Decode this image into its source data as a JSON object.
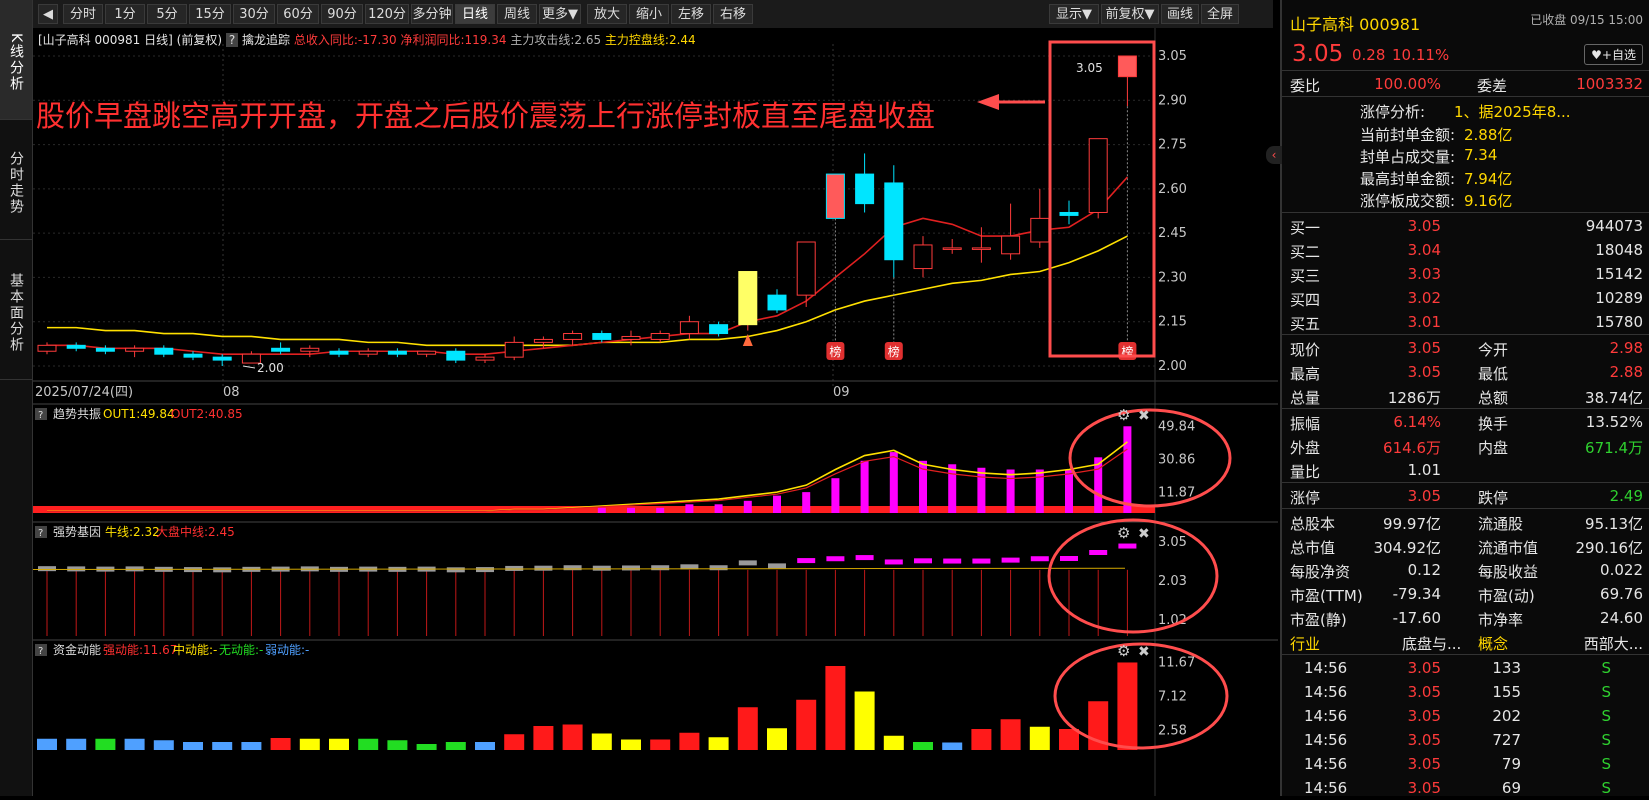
{
  "toolbar": {
    "periods": [
      "分时",
      "1分",
      "5分",
      "15分",
      "30分",
      "60分",
      "90分",
      "120分",
      "多分钟",
      "日线",
      "周线",
      "更多▼"
    ],
    "active": "日线",
    "tools": [
      "放大",
      "缩小",
      "左移",
      "右移"
    ],
    "right_tools": [
      "显示▼",
      "前复权▼",
      "画线",
      "全屏"
    ]
  },
  "left_nav": [
    "K线分析",
    "分时走势",
    "基本面分析"
  ],
  "main_header": {
    "stock": "[山子高科 000981 日线]",
    "adj": "(前复权)",
    "help": "?",
    "indicator": "擒龙追踪",
    "income": "总收入同比:-17.30",
    "profit": "净利润同比:119.34",
    "attack": "主力攻击线:2.65",
    "control": "主力控盘线:2.44"
  },
  "annotation": "股价早盘跳空高开开盘，开盘之后股价震荡上行涨停封板直至尾盘收盘",
  "price_axis": [
    "3.05",
    "2.90",
    "2.75",
    "2.60",
    "2.45",
    "2.30",
    "2.15",
    "2.00"
  ],
  "date_labels": [
    "2025/07/24(四)",
    "08",
    "09"
  ],
  "low_label": "2.00",
  "high_label": "3.05",
  "bang_label": "榜",
  "panel1": {
    "name": "趋势共振",
    "out1": "OUT1:49.84",
    "out2": "OUT2:40.85",
    "axis": [
      "49.84",
      "30.86",
      "11.87"
    ]
  },
  "panel2": {
    "name": "强势基因",
    "bull": "牛线:2.32",
    "market": "大盘中线:2.45",
    "axis": [
      "3.05",
      "2.03",
      "1.02"
    ]
  },
  "panel3": {
    "name": "资金动能",
    "strong": "强动能:11.67",
    "mid": "中动能:-",
    "none": "无动能:-",
    "weak": "弱动能:-",
    "axis": [
      "11.67",
      "7.12",
      "2.58"
    ]
  },
  "colors": {
    "up": "#ff3b3b",
    "down": "#00e5ff",
    "ma_yellow": "#ffe000",
    "ma_red": "#e02020",
    "magenta": "#ff00ff",
    "frame": "#ff4d4d"
  },
  "chart_data": {
    "type": "candlestick",
    "ylim": [
      2.0,
      3.1
    ],
    "candles": [
      {
        "o": 2.05,
        "h": 2.08,
        "l": 2.04,
        "c": 2.07
      },
      {
        "o": 2.07,
        "h": 2.08,
        "l": 2.05,
        "c": 2.06
      },
      {
        "o": 2.06,
        "h": 2.07,
        "l": 2.04,
        "c": 2.05
      },
      {
        "o": 2.05,
        "h": 2.07,
        "l": 2.03,
        "c": 2.06
      },
      {
        "o": 2.06,
        "h": 2.07,
        "l": 2.03,
        "c": 2.04
      },
      {
        "o": 2.04,
        "h": 2.05,
        "l": 2.02,
        "c": 2.03
      },
      {
        "o": 2.03,
        "h": 2.04,
        "l": 2.0,
        "c": 2.02
      },
      {
        "o": 2.01,
        "h": 2.05,
        "l": 2.01,
        "c": 2.04
      },
      {
        "o": 2.06,
        "h": 2.08,
        "l": 2.04,
        "c": 2.05
      },
      {
        "o": 2.05,
        "h": 2.07,
        "l": 2.03,
        "c": 2.06
      },
      {
        "o": 2.05,
        "h": 2.06,
        "l": 2.03,
        "c": 2.04
      },
      {
        "o": 2.04,
        "h": 2.06,
        "l": 2.03,
        "c": 2.05
      },
      {
        "o": 2.05,
        "h": 2.06,
        "l": 2.03,
        "c": 2.04
      },
      {
        "o": 2.04,
        "h": 2.05,
        "l": 2.03,
        "c": 2.05
      },
      {
        "o": 2.05,
        "h": 2.06,
        "l": 2.01,
        "c": 2.02
      },
      {
        "o": 2.02,
        "h": 2.04,
        "l": 2.01,
        "c": 2.03
      },
      {
        "o": 2.03,
        "h": 2.1,
        "l": 2.02,
        "c": 2.08
      },
      {
        "o": 2.08,
        "h": 2.1,
        "l": 2.06,
        "c": 2.09
      },
      {
        "o": 2.09,
        "h": 2.12,
        "l": 2.07,
        "c": 2.11
      },
      {
        "o": 2.11,
        "h": 2.12,
        "l": 2.08,
        "c": 2.09
      },
      {
        "o": 2.09,
        "h": 2.12,
        "l": 2.07,
        "c": 2.1
      },
      {
        "o": 2.09,
        "h": 2.12,
        "l": 2.08,
        "c": 2.11
      },
      {
        "o": 2.11,
        "h": 2.17,
        "l": 2.09,
        "c": 2.15
      },
      {
        "o": 2.14,
        "h": 2.15,
        "l": 2.1,
        "c": 2.11
      },
      {
        "o": 2.14,
        "h": 2.3,
        "l": 2.12,
        "c": 2.32
      },
      {
        "o": 2.24,
        "h": 2.26,
        "l": 2.18,
        "c": 2.19
      },
      {
        "o": 2.24,
        "h": 2.42,
        "l": 2.2,
        "c": 2.42
      },
      {
        "o": 2.65,
        "h": 2.65,
        "l": 2.5,
        "c": 2.5
      },
      {
        "o": 2.65,
        "h": 2.72,
        "l": 2.52,
        "c": 2.55
      },
      {
        "o": 2.62,
        "h": 2.68,
        "l": 2.3,
        "c": 2.36
      },
      {
        "o": 2.33,
        "h": 2.44,
        "l": 2.3,
        "c": 2.41
      },
      {
        "o": 2.4,
        "h": 2.43,
        "l": 2.38,
        "c": 2.4
      },
      {
        "o": 2.4,
        "h": 2.47,
        "l": 2.35,
        "c": 2.4
      },
      {
        "o": 2.38,
        "h": 2.55,
        "l": 2.36,
        "c": 2.44
      },
      {
        "o": 2.42,
        "h": 2.6,
        "l": 2.4,
        "c": 2.5
      },
      {
        "o": 2.52,
        "h": 2.56,
        "l": 2.48,
        "c": 2.51
      },
      {
        "o": 2.52,
        "h": 2.77,
        "l": 2.5,
        "c": 2.77
      },
      {
        "o": 2.98,
        "h": 3.05,
        "l": 2.88,
        "c": 3.05
      }
    ],
    "ma_red": [
      2.07,
      2.07,
      2.06,
      2.06,
      2.06,
      2.05,
      2.04,
      2.04,
      2.04,
      2.04,
      2.05,
      2.05,
      2.05,
      2.05,
      2.04,
      2.04,
      2.05,
      2.06,
      2.07,
      2.08,
      2.09,
      2.1,
      2.11,
      2.11,
      2.15,
      2.17,
      2.22,
      2.3,
      2.38,
      2.47,
      2.5,
      2.48,
      2.44,
      2.44,
      2.46,
      2.47,
      2.53,
      2.64
    ],
    "ma_yellow": [
      2.13,
      2.13,
      2.12,
      2.12,
      2.11,
      2.11,
      2.1,
      2.1,
      2.09,
      2.09,
      2.09,
      2.08,
      2.08,
      2.07,
      2.07,
      2.07,
      2.07,
      2.07,
      2.07,
      2.08,
      2.08,
      2.08,
      2.09,
      2.09,
      2.1,
      2.12,
      2.15,
      2.19,
      2.22,
      2.24,
      2.26,
      2.28,
      2.29,
      2.31,
      2.32,
      2.35,
      2.39,
      2.44
    ],
    "panel1_bars": [
      0,
      0,
      0,
      0,
      0,
      0,
      0,
      0,
      0,
      0,
      0,
      0,
      0,
      0,
      0,
      0,
      0,
      0,
      0,
      3,
      3,
      3,
      5,
      5,
      7,
      10,
      12,
      20,
      30,
      35,
      30,
      28,
      26,
      25,
      25,
      25,
      32,
      49.84
    ],
    "panel1_line": [
      1,
      1,
      1,
      1,
      1,
      1,
      1,
      1,
      1,
      1,
      1,
      1,
      1,
      1,
      1,
      1,
      2,
      2,
      3,
      4,
      5,
      6,
      7,
      8,
      10,
      12,
      16,
      25,
      33,
      36,
      28,
      25,
      23,
      22,
      23,
      25,
      28,
      40.85
    ],
    "panel3_bars": [
      1.5,
      1.5,
      1.5,
      1.5,
      1.3,
      -1,
      -1,
      -1,
      1.6,
      1.5,
      1.5,
      1.5,
      1.3,
      0.8,
      -1,
      -1,
      2.1,
      3.2,
      3.4,
      2.2,
      1.4,
      1.4,
      2.3,
      1.7,
      5.7,
      2.9,
      6.7,
      11.2,
      7.8,
      1.9,
      -3,
      1,
      2.8,
      4.1,
      3.1,
      2.8,
      6.5,
      11.67
    ],
    "panel3_colors": [
      "blue",
      "blue",
      "green",
      "blue",
      "blue",
      "blue",
      "blue",
      "blue",
      "red",
      "yellow",
      "yellow",
      "green",
      "green",
      "green",
      "green",
      "blue",
      "red",
      "red",
      "red",
      "yellow",
      "yellow",
      "red",
      "red",
      "yellow",
      "red",
      "yellow",
      "red",
      "red",
      "yellow",
      "yellow",
      "green",
      "blue",
      "red",
      "red",
      "yellow",
      "red",
      "red",
      "red"
    ]
  },
  "right": {
    "title": "山子高科 000981",
    "status": "已收盘 09/15 15:00",
    "price": "3.05",
    "change": "0.28",
    "pct": "10.11%",
    "add_btn": "♥+自选",
    "webi_label": "委比",
    "webi": "100.00%",
    "weicha_label": "委差",
    "weicha": "1003332",
    "zt_analysis_label": "涨停分析:",
    "zt_analysis": "1、据2025年8...",
    "zt_rows": [
      {
        "label": "当前封单金额:",
        "value": "2.88亿"
      },
      {
        "label": "封单占成交量:",
        "value": "7.34"
      },
      {
        "label": "最高封单金额:",
        "value": "7.94亿"
      },
      {
        "label": "涨停板成交额:",
        "value": "9.16亿"
      }
    ],
    "buy": [
      {
        "label": "买一",
        "price": "3.05",
        "vol": "944073"
      },
      {
        "label": "买二",
        "price": "3.04",
        "vol": "18048"
      },
      {
        "label": "买三",
        "price": "3.03",
        "vol": "15142"
      },
      {
        "label": "买四",
        "price": "3.02",
        "vol": "10289"
      },
      {
        "label": "买五",
        "price": "3.01",
        "vol": "15780"
      }
    ],
    "stats": [
      {
        "l1": "现价",
        "v1": "3.05",
        "c1": "red",
        "l2": "今开",
        "v2": "2.98",
        "c2": "red"
      },
      {
        "l1": "最高",
        "v1": "3.05",
        "c1": "red",
        "l2": "最低",
        "v2": "2.88",
        "c2": "red"
      },
      {
        "l1": "总量",
        "v1": "1286万",
        "c1": "white",
        "l2": "总额",
        "v2": "38.74亿",
        "c2": "white"
      }
    ],
    "stats2": [
      {
        "l1": "振幅",
        "v1": "6.14%",
        "c1": "red",
        "l2": "换手",
        "v2": "13.52%",
        "c2": "white"
      },
      {
        "l1": "外盘",
        "v1": "614.6万",
        "c1": "red",
        "l2": "内盘",
        "v2": "671.4万",
        "c2": "green"
      },
      {
        "l1": "量比",
        "v1": "1.01",
        "c1": "white",
        "l2": "",
        "v2": "",
        "c2": "white"
      }
    ],
    "limit": {
      "l1": "涨停",
      "v1": "3.05",
      "l2": "跌停",
      "v2": "2.49"
    },
    "fundamentals": [
      {
        "l1": "总股本",
        "v1": "99.97亿",
        "l2": "流通股",
        "v2": "95.13亿"
      },
      {
        "l1": "总市值",
        "v1": "304.92亿",
        "l2": "流通市值",
        "v2": "290.16亿"
      },
      {
        "l1": "每股净资",
        "v1": "0.12",
        "l2": "每股收益",
        "v2": "0.022"
      },
      {
        "l1": "市盈(TTM)",
        "v1": "-79.34",
        "l2": "市盈(动)",
        "v2": "69.76"
      },
      {
        "l1": "市盈(静)",
        "v1": "-17.60",
        "l2": "市净率",
        "v2": "24.60"
      }
    ],
    "industry": {
      "l1": "行业",
      "v1": "底盘与...",
      "l2": "概念",
      "v2": "西部大..."
    },
    "ticks": [
      {
        "time": "14:56",
        "price": "3.05",
        "vol": "133",
        "dir": "S"
      },
      {
        "time": "14:56",
        "price": "3.05",
        "vol": "155",
        "dir": "S"
      },
      {
        "time": "14:56",
        "price": "3.05",
        "vol": "202",
        "dir": "S"
      },
      {
        "time": "14:56",
        "price": "3.05",
        "vol": "727",
        "dir": "S"
      },
      {
        "time": "14:56",
        "price": "3.05",
        "vol": "79",
        "dir": "S"
      },
      {
        "time": "14:56",
        "price": "3.05",
        "vol": "69",
        "dir": "S"
      }
    ]
  }
}
